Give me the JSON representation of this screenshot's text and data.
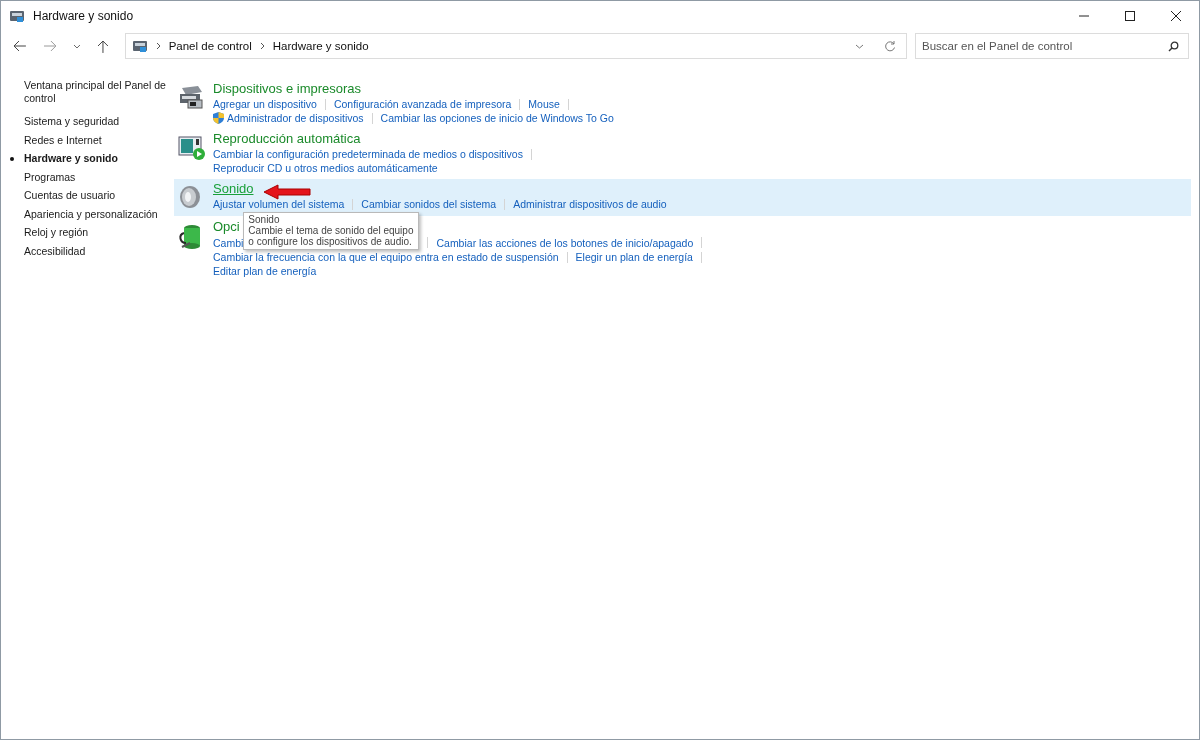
{
  "window": {
    "title": "Hardware y sonido"
  },
  "address": {
    "crumbs": [
      "Panel de control",
      "Hardware y sonido"
    ]
  },
  "search": {
    "placeholder": "Buscar en el Panel de control"
  },
  "sidebar": {
    "items": [
      {
        "label": "Ventana principal del Panel de control",
        "selected": false
      },
      {
        "label": "Sistema y seguridad",
        "selected": false
      },
      {
        "label": "Redes e Internet",
        "selected": false
      },
      {
        "label": "Hardware y sonido",
        "selected": true
      },
      {
        "label": "Programas",
        "selected": false
      },
      {
        "label": "Cuentas de usuario",
        "selected": false
      },
      {
        "label": "Apariencia y personalización",
        "selected": false
      },
      {
        "label": "Reloj y región",
        "selected": false
      },
      {
        "label": "Accesibilidad",
        "selected": false
      }
    ]
  },
  "sections": [
    {
      "kind": "devices",
      "title": "Dispositivos e impresoras",
      "hovered": false,
      "lines": [
        {
          "links": [
            {
              "kind": "plain",
              "text": "Agregar un dispositivo"
            },
            {
              "kind": "plain",
              "text": "Configuración avanzada de impresora"
            },
            {
              "kind": "plain",
              "text": "Mouse"
            }
          ]
        },
        {
          "links": [
            {
              "kind": "admin",
              "text": "Administrador de dispositivos"
            },
            {
              "kind": "plain",
              "text": "Cambiar las opciones de inicio de Windows To Go"
            }
          ]
        }
      ]
    },
    {
      "kind": "autoplay",
      "title": "Reproducción automática",
      "hovered": false,
      "lines": [
        {
          "links": [
            {
              "kind": "plain",
              "text": "Cambiar la configuración predeterminada de medios o dispositivos"
            }
          ]
        },
        {
          "links": [
            {
              "kind": "plain",
              "text": "Reproducir CD u otros medios automáticamente"
            }
          ]
        }
      ]
    },
    {
      "kind": "sound",
      "title": "Sonido",
      "hovered": true,
      "lines": [
        {
          "links": [
            {
              "kind": "plain",
              "text": "Ajustar volumen del sistema"
            },
            {
              "kind": "plain",
              "text": "Cambiar sonidos del sistema"
            },
            {
              "kind": "plain",
              "text": "Administrar dispositivos de audio"
            }
          ]
        }
      ]
    },
    {
      "kind": "power",
      "title": "Opci",
      "hovered": false,
      "lines": [
        {
          "links": [
            {
              "kind": "plain",
              "text": "Cambi"
            },
            {
              "kind": "plain",
              "text": "Cambiar las acciones de los botones de inicio/apagado"
            }
          ],
          "tooltip": {
            "title": "Sonido",
            "lines": [
              "Cambie el tema de sonido del equipo",
              "o configure los dispositivos de audio."
            ]
          }
        },
        {
          "links": [
            {
              "kind": "plain",
              "text": "Cambiar la frecuencia con la que el equipo entra en estado de suspensión"
            },
            {
              "kind": "plain",
              "text": "Elegir un plan de energía"
            }
          ]
        },
        {
          "links": [
            {
              "kind": "plain",
              "text": "Editar plan de energía"
            }
          ]
        }
      ]
    }
  ]
}
